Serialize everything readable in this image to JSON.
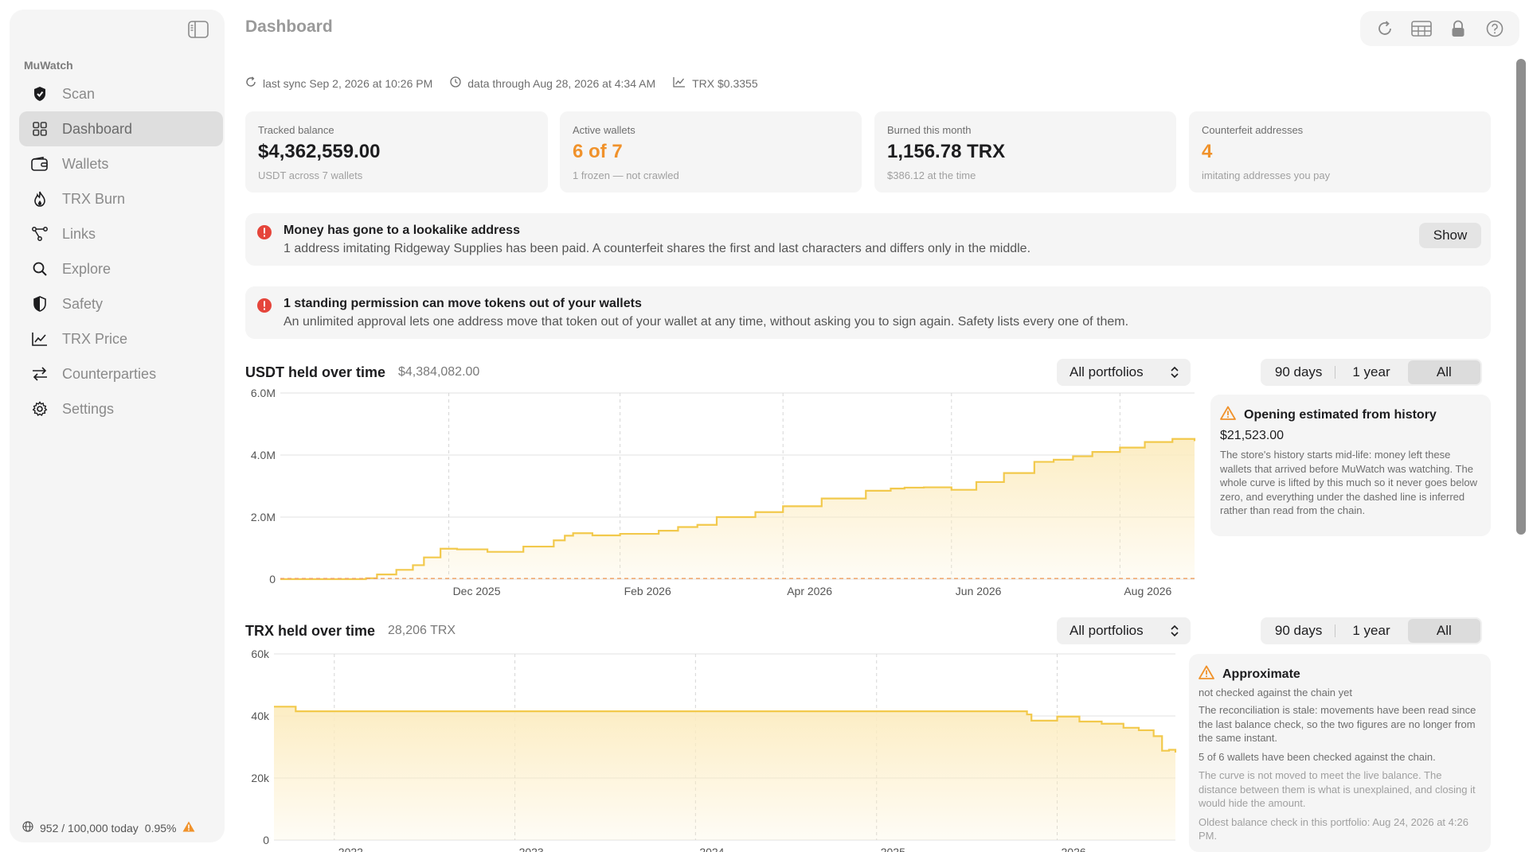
{
  "sidebar": {
    "section": "MuWatch",
    "items": [
      {
        "label": "Scan"
      },
      {
        "label": "Dashboard"
      },
      {
        "label": "Wallets"
      },
      {
        "label": "TRX Burn"
      },
      {
        "label": "Links"
      },
      {
        "label": "Explore"
      },
      {
        "label": "Safety"
      },
      {
        "label": "TRX Price"
      },
      {
        "label": "Counterparties"
      },
      {
        "label": "Settings"
      }
    ],
    "footer": {
      "usage": "952 / 100,000 today",
      "percent": "0.95%"
    }
  },
  "header": {
    "title": "Dashboard"
  },
  "sync": {
    "last_sync": "last sync Sep 2, 2026 at 10:26 PM",
    "data_through": "data through Aug 28, 2026 at 4:34 AM",
    "trx_price": "TRX $0.3355"
  },
  "cards": [
    {
      "title": "Tracked balance",
      "value": "$4,362,559.00",
      "sub": "USDT across 7 wallets"
    },
    {
      "title": "Active wallets",
      "value": "6 of 7",
      "sub": "1 frozen — not crawled"
    },
    {
      "title": "Burned this month",
      "value": "1,156.78 TRX",
      "sub": "$386.12 at the time"
    },
    {
      "title": "Counterfeit addresses",
      "value": "4",
      "sub": "imitating addresses you pay"
    }
  ],
  "alerts": [
    {
      "title": "Money has gone to a lookalike address",
      "body": "1 address imitating Ridgeway Supplies has been paid. A counterfeit shares the first and last characters and differs only in the middle.",
      "button": "Show"
    },
    {
      "title": "1 standing permission can move tokens out of your wallets",
      "body": "An unlimited approval lets one address move that token out of your wallet at any time, without asking you to sign again. Safety lists every one of them."
    }
  ],
  "usdt_section": {
    "title": "USDT held over time",
    "value": "$4,384,082.00",
    "portfolio": "All portfolios",
    "ranges": [
      "90 days",
      "1 year",
      "All"
    ],
    "note": {
      "title": "Opening estimated from history",
      "value": "$21,523.00",
      "body": "The store's history starts mid-life: money left these wallets that arrived before MuWatch was watching. The whole curve is lifted by this much so it never goes below zero, and everything under the dashed line is inferred rather than read from the chain."
    }
  },
  "trx_section": {
    "title": "TRX held over time",
    "value": "28,206 TRX",
    "portfolio": "All portfolios",
    "ranges": [
      "90 days",
      "1 year",
      "All"
    ],
    "note": {
      "title": "Approximate",
      "sub": "not checked against the chain yet",
      "p1": "The reconciliation is stale: movements have been read since the last balance check, so the two figures are no longer from the same instant.",
      "p2": "5 of 6 wallets have been checked against the chain.",
      "p3": "The curve is not moved to meet the live balance. The distance between them is what is unexplained, and closing it would hide the amount.",
      "p4": "Oldest balance check in this portfolio: Aug 24, 2026 at 4:26 PM."
    }
  },
  "colors": {
    "accent": "#f0922b",
    "alert_red": "#e5453b",
    "line": "#f2c94c",
    "fill": "#fcecc0"
  },
  "chart_data": [
    {
      "type": "area",
      "title": "USDT held over time",
      "ylim": [
        0,
        6000000
      ],
      "yticks": [
        0,
        2000000,
        4000000,
        6000000
      ],
      "ytick_labels": [
        "0",
        "2.0M",
        "4.0M",
        "6.0M"
      ],
      "xlim": [
        "2025-10-01",
        "2026-08-28"
      ],
      "xticks": [
        "2025-12-01",
        "2026-02-01",
        "2026-04-01",
        "2026-06-01",
        "2026-08-01"
      ],
      "xtick_labels": [
        "Dec 2025",
        "Feb 2026",
        "Apr 2026",
        "Jun 2026",
        "Aug 2026"
      ],
      "baseline": 21523,
      "series": [
        {
          "x": [
            "2025-10-01",
            "2025-11-01",
            "2025-11-05",
            "2025-11-12",
            "2025-11-18",
            "2025-11-22",
            "2025-11-28",
            "2025-12-04",
            "2025-12-15",
            "2025-12-28",
            "2026-01-08",
            "2026-01-12",
            "2026-01-15",
            "2026-01-22",
            "2026-02-01",
            "2026-02-15",
            "2026-02-22",
            "2026-03-01",
            "2026-03-08",
            "2026-03-22",
            "2026-04-01",
            "2026-04-15",
            "2026-05-01",
            "2026-05-10",
            "2026-05-15",
            "2026-05-22",
            "2026-06-01",
            "2026-06-10",
            "2026-06-20",
            "2026-07-01",
            "2026-07-08",
            "2026-07-15",
            "2026-07-22",
            "2026-08-01",
            "2026-08-10",
            "2026-08-20",
            "2026-08-28"
          ],
          "y": [
            0,
            30000,
            150000,
            300000,
            450000,
            700000,
            980000,
            960000,
            880000,
            1050000,
            1250000,
            1400000,
            1480000,
            1410000,
            1460000,
            1560000,
            1680000,
            1750000,
            2000000,
            2160000,
            2350000,
            2600000,
            2850000,
            2920000,
            2950000,
            2960000,
            2880000,
            3130000,
            3420000,
            3780000,
            3850000,
            3960000,
            4100000,
            4240000,
            4420000,
            4520000,
            4450000
          ]
        }
      ]
    },
    {
      "type": "area",
      "title": "TRX held over time",
      "ylim": [
        0,
        60000
      ],
      "yticks": [
        0,
        20000,
        40000,
        60000
      ],
      "ytick_labels": [
        "0",
        "20k",
        "40k",
        "60k"
      ],
      "xlim": [
        "2021-09-01",
        "2026-08-28"
      ],
      "xticks": [
        "2022-01-01",
        "2023-01-01",
        "2024-01-01",
        "2025-01-01",
        "2026-01-01"
      ],
      "xtick_labels": [
        "2022",
        "2023",
        "2024",
        "2025",
        "2026"
      ],
      "series": [
        {
          "x": [
            "2021-09-01",
            "2021-10-15",
            "2025-09-01",
            "2025-11-01",
            "2025-11-10",
            "2026-01-01",
            "2026-02-15",
            "2026-04-01",
            "2026-05-15",
            "2026-06-15",
            "2026-07-15",
            "2026-08-01",
            "2026-08-15",
            "2026-08-28"
          ],
          "y": [
            43000,
            41500,
            41500,
            40500,
            38500,
            39800,
            38200,
            37500,
            36200,
            35400,
            33500,
            28800,
            29100,
            28206
          ]
        }
      ]
    }
  ]
}
